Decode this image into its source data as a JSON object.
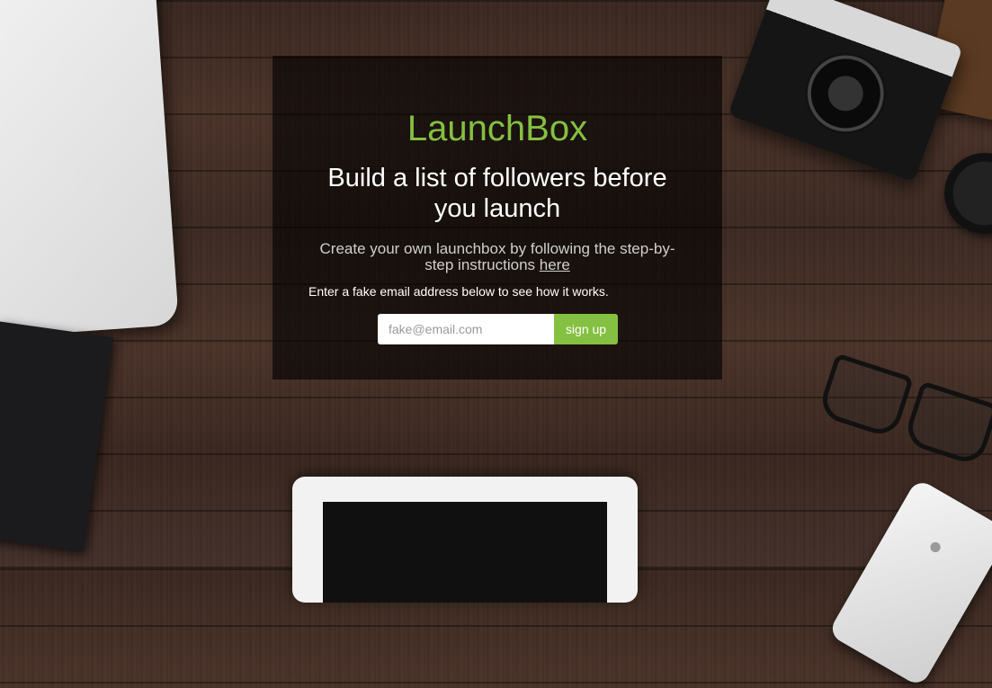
{
  "brand": "LaunchBox",
  "headline": "Build a list of followers before you launch",
  "subtext": {
    "prefix": "Create your own launchbox by following the step-by-step instructions ",
    "link_label": "here"
  },
  "instructions": "Enter a fake email address below to see how it works.",
  "signup": {
    "email_placeholder": "fake@email.com",
    "email_value": "",
    "button_label": "sign up"
  },
  "colors": {
    "accent": "#84c041",
    "panel_overlay": "rgba(0,0,0,0.62)"
  },
  "icons": [
    "apple-icon"
  ]
}
